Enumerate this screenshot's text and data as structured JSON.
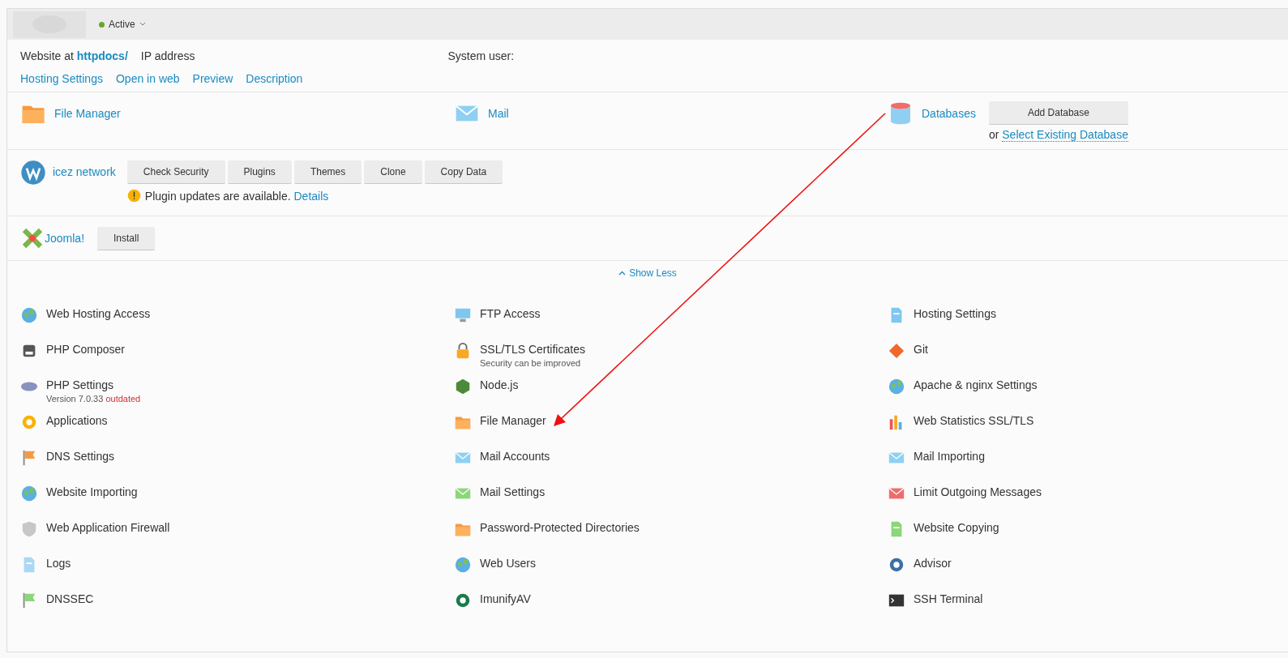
{
  "header": {
    "status": "Active"
  },
  "info": {
    "website_label": "Website at",
    "website_path": "httpdocs/",
    "ip_label": "IP address",
    "system_user_label": "System user:"
  },
  "links": [
    "Hosting Settings",
    "Open in web",
    "Preview",
    "Description"
  ],
  "top_row": [
    {
      "label": "File Manager"
    },
    {
      "label": "Mail"
    },
    {
      "label": "Databases",
      "button": "Add Database",
      "or": "or",
      "link": "Select Existing Database"
    }
  ],
  "wordpress": {
    "label": "icez network",
    "buttons": [
      "Check Security",
      "Plugins",
      "Themes",
      "Clone",
      "Copy Data"
    ],
    "notice": "Plugin updates are available.",
    "notice_link": "Details"
  },
  "joomla": {
    "label": "Joomla!",
    "button": "Install"
  },
  "toggle": {
    "label": "Show Less",
    "expanded": true
  },
  "tools": [
    {
      "label": "Web Hosting Access"
    },
    {
      "label": "FTP Access"
    },
    {
      "label": "Hosting Settings"
    },
    {
      "label": "PHP Composer"
    },
    {
      "label": "SSL/TLS Certificates",
      "note": "Security can be improved"
    },
    {
      "label": "Git"
    },
    {
      "label": "PHP Settings",
      "note": "Version 7.0.33",
      "warning": "outdated"
    },
    {
      "label": "Node.js"
    },
    {
      "label": "Apache & nginx Settings"
    },
    {
      "label": "Applications"
    },
    {
      "label": "File Manager"
    },
    {
      "label": "Web Statistics SSL/TLS"
    },
    {
      "label": "DNS Settings"
    },
    {
      "label": "Mail Accounts"
    },
    {
      "label": "Mail Importing"
    },
    {
      "label": "Website Importing"
    },
    {
      "label": "Mail Settings"
    },
    {
      "label": "Limit Outgoing Messages"
    },
    {
      "label": "Web Application Firewall"
    },
    {
      "label": "Password-Protected Directories"
    },
    {
      "label": "Website Copying"
    },
    {
      "label": "Logs"
    },
    {
      "label": "Web Users"
    },
    {
      "label": "Advisor"
    },
    {
      "label": "DNSSEC"
    },
    {
      "label": "ImunifyAV"
    },
    {
      "label": "SSH Terminal"
    }
  ]
}
